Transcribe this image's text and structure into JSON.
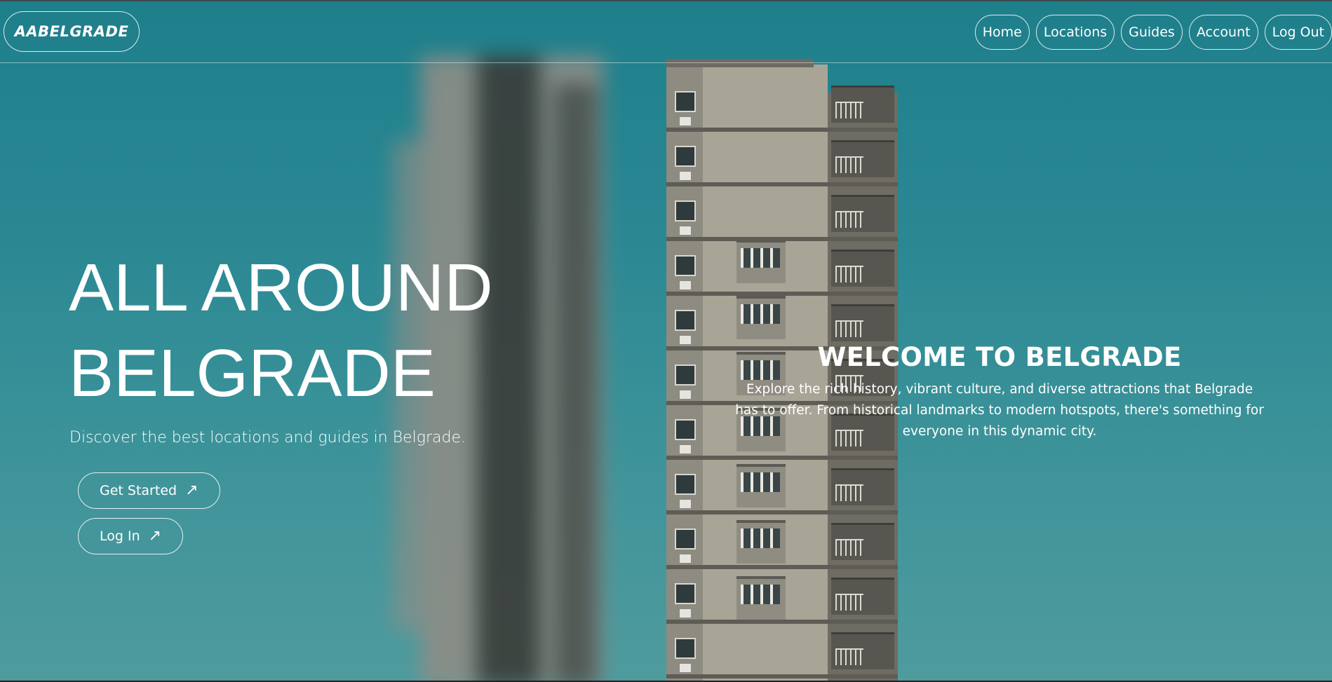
{
  "brand": {
    "logo": "AABELGRADE"
  },
  "nav": {
    "items": [
      {
        "label": "Home"
      },
      {
        "label": "Locations"
      },
      {
        "label": "Guides"
      },
      {
        "label": "Account"
      },
      {
        "label": "Log Out"
      }
    ]
  },
  "hero": {
    "title_line1": "ALL AROUND",
    "title_line2": "BELGRADE",
    "subtitle": "Discover the best locations and guides in Belgrade.",
    "get_started_label": "Get Started",
    "log_in_label": "Log In",
    "arrow_glyph": "↗"
  },
  "welcome": {
    "title": "WELCOME TO BELGRADE",
    "text": "Explore the rich history, vibrant culture, and diverse attractions that Belgrade has to offer. From historical landmarks to modern hotspots, there's something for everyone in this dynamic city."
  },
  "colors": {
    "background_top": "#1e7f8b",
    "background_bottom": "#4f9b9e",
    "text": "#ffffff"
  },
  "icons": {
    "arrow": "arrow-up-right-icon"
  }
}
